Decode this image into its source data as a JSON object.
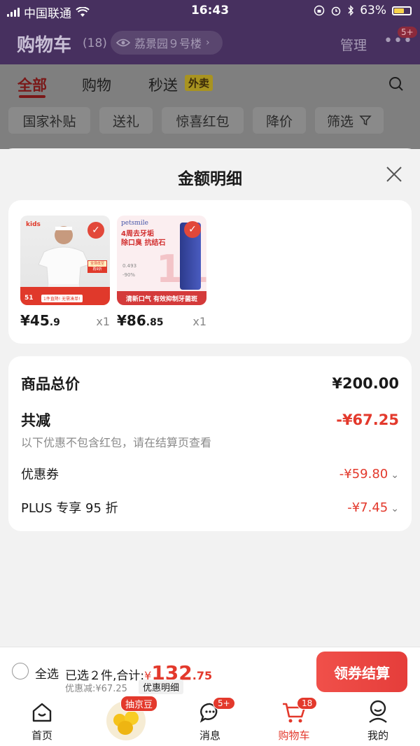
{
  "status": {
    "carrier": "中国联通",
    "time": "16:43",
    "battery": "63%"
  },
  "header": {
    "title": "购物车",
    "count": "(18)",
    "location": "荔景园９号楼",
    "manage": "管理",
    "more_badge": "5+"
  },
  "tabs": [
    {
      "label": "全部",
      "active": true
    },
    {
      "label": "购物",
      "active": false
    },
    {
      "label": "秒送",
      "active": false
    }
  ],
  "waimai": "外卖",
  "chips": [
    "国家补贴",
    "送礼",
    "惊喜红包",
    "降价",
    "筛选"
  ],
  "sheet": {
    "title": "金额明细",
    "products": [
      {
        "price_int": "¥45",
        "price_dec": ".9",
        "qty": "x1",
        "img": {
          "brand": "kids",
          "tag1": "全场低至",
          "tag2": "再9折",
          "banner": "1件直降! 无需凑单!",
          "num": "51"
        }
      },
      {
        "price_int": "¥86",
        "price_dec": ".85",
        "qty": "x1",
        "img": {
          "brand": "petsmile",
          "line1": "4周去牙垢",
          "line2": "除口臭 抗结石",
          "v1": "0.493",
          "v2": "-90%",
          "banner": "清新口气 有效抑制牙菌斑"
        }
      }
    ],
    "total_label": "商品总价",
    "total_value": "¥200.00",
    "reduce_label": "共减",
    "reduce_value": "-¥67.25",
    "reduce_note": "以下优惠不包含红包，请在结算页查看",
    "coupon_label": "优惠券",
    "coupon_value": "-¥59.80",
    "plus_label": "PLUS 专享 95 折",
    "plus_value": "-¥7.45"
  },
  "bottom": {
    "select_all": "全选",
    "selected": "已选２件,合计:",
    "currency": "¥",
    "amount_int": "132",
    "amount_dec": ".75",
    "discount": "优惠减:¥67.25",
    "detail": "优惠明细",
    "checkout": "领券结算"
  },
  "nav": [
    {
      "label": "首页",
      "icon": "home-icon"
    },
    {
      "label": "",
      "icon": "jingdou-icon",
      "badge": "抽京豆"
    },
    {
      "label": "消息",
      "icon": "message-icon",
      "badge": "5+"
    },
    {
      "label": "购物车",
      "icon": "cart-icon",
      "badge": "18",
      "active": true
    },
    {
      "label": "我的",
      "icon": "profile-icon"
    }
  ],
  "colors": {
    "accent": "#e3392c",
    "header_bg": "#47305f"
  }
}
